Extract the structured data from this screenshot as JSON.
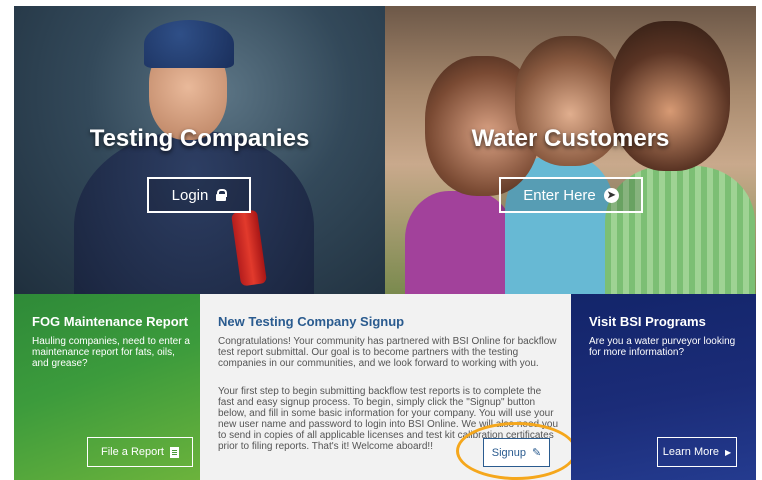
{
  "hero": {
    "testing": {
      "title": "Testing Companies",
      "button_label": "Login"
    },
    "water": {
      "title": "Water Customers",
      "button_label": "Enter Here"
    }
  },
  "fog": {
    "title": "FOG Maintenance Report",
    "text": "Hauling companies, need to enter a maintenance report for fats, oils, and grease?",
    "button_label": "File a Report"
  },
  "signup": {
    "title": "New Testing Company Signup",
    "paragraph1": "Congratulations! Your community has partnered with BSI Online for backflow test report submittal. Our goal is to become partners with the testing companies in our communities, and we look forward to working with you.",
    "paragraph2": "Your first step to begin submitting backflow test reports is to complete the fast and easy signup process. To begin, simply click the \"Signup\" button below, and fill in some basic information for your company. You will use your new user name and password to login into BSI Online. We will also need you to send in copies of all applicable licenses and test kit calibration certificates prior to filing reports. That's it! Welcome aboard!!",
    "button_label": "Signup"
  },
  "bsi": {
    "title": "Visit BSI Programs",
    "text": "Are you a water purveyor looking for more information?",
    "button_label": "Learn More"
  },
  "icons": {
    "lock": "lock-icon",
    "enter": "circle-arrow-right-icon",
    "file": "file-text-icon",
    "pencil": "pencil-icon",
    "caret": "caret-right-icon"
  },
  "colors": {
    "fog_green": "#3c9b3c",
    "bsi_navy": "#1b2c78",
    "signup_blue": "#2a5b8f",
    "highlight": "#f5a71c"
  }
}
